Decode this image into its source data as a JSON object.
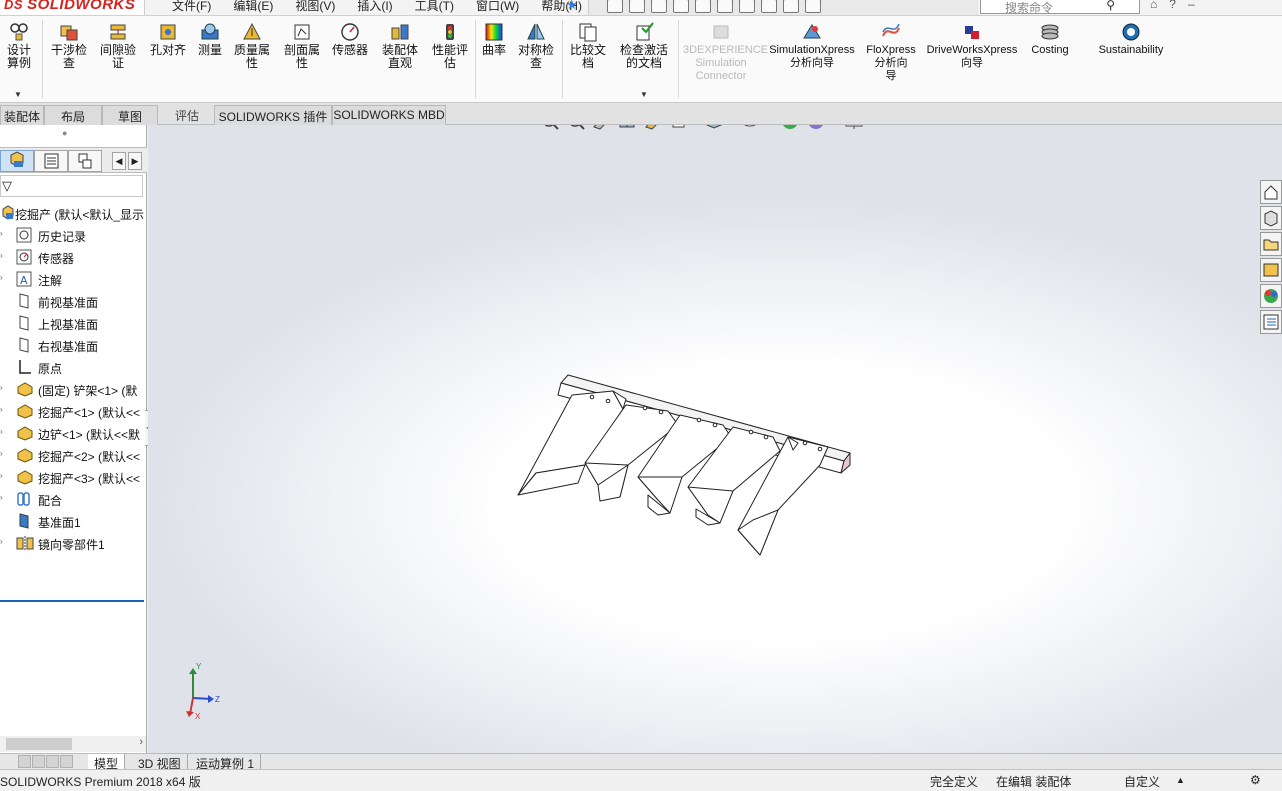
{
  "app": {
    "logo_ds": "DS",
    "logo_name": "SOLIDWORKS"
  },
  "menu": [
    "文件(F)",
    "编辑(E)",
    "视图(V)",
    "插入(I)",
    "工具(T)",
    "窗口(W)",
    "帮助(H)"
  ],
  "search": {
    "placeholder": "搜索命令"
  },
  "ribbon": {
    "design_study": "设计算例",
    "interference": "干涉检查",
    "clearance": "间隙验证",
    "hole_align": "孔对齐",
    "measure": "测量",
    "mass_props": "质量属性",
    "section_props": "剖面属性",
    "sensor": "传感器",
    "assembly_vis": "装配体直观",
    "perf_eval": "性能评估",
    "curvature": "曲率",
    "symmetry": "对称检查",
    "compare": "比较文档",
    "check_active": "检查激活的文档",
    "sim_connector": "3DEXPERIENCE Simulation Connector",
    "simxpress_en": "SimulationXpress",
    "simxpress_cn": "分析向导",
    "floxpress_en": "FloXpress",
    "floxpress_cn": "分析向导",
    "driveworks_en": "DriveWorksXpress",
    "driveworks_cn": "向导",
    "costing": "Costing",
    "sustainability": "Sustainability"
  },
  "tabs": [
    "装配体",
    "布局",
    "草图",
    "评估",
    "SOLIDWORKS 插件",
    "SOLIDWORKS MBD"
  ],
  "tree": {
    "root": "挖掘产 (默认<默认_显示",
    "items": [
      {
        "label": "历史记录"
      },
      {
        "label": "传感器"
      },
      {
        "label": "注解"
      },
      {
        "label": "前视基准面"
      },
      {
        "label": "上视基准面"
      },
      {
        "label": "右视基准面"
      },
      {
        "label": "原点"
      },
      {
        "label": "(固定) 铲架<1> (默"
      },
      {
        "label": "挖掘产<1> (默认<<"
      },
      {
        "label": "边铲<1> (默认<<默"
      },
      {
        "label": "挖掘产<2> (默认<<"
      },
      {
        "label": "挖掘产<3> (默认<<"
      },
      {
        "label": "配合"
      },
      {
        "label": "基准面1"
      },
      {
        "label": "镜向零部件1"
      }
    ]
  },
  "triad": {
    "x": "X",
    "y": "Y",
    "z": "Z"
  },
  "bottom_tabs": [
    "模型",
    "3D 视图",
    "运动算例 1"
  ],
  "status": {
    "product": "SOLIDWORKS Premium 2018 x64 版",
    "defined": "完全定义",
    "editing": "在编辑 装配体",
    "custom": "自定义"
  },
  "colors": {
    "accent": "#1e5fb4",
    "logo_red": "#d6231e",
    "disabled": "#b9b9b9"
  }
}
